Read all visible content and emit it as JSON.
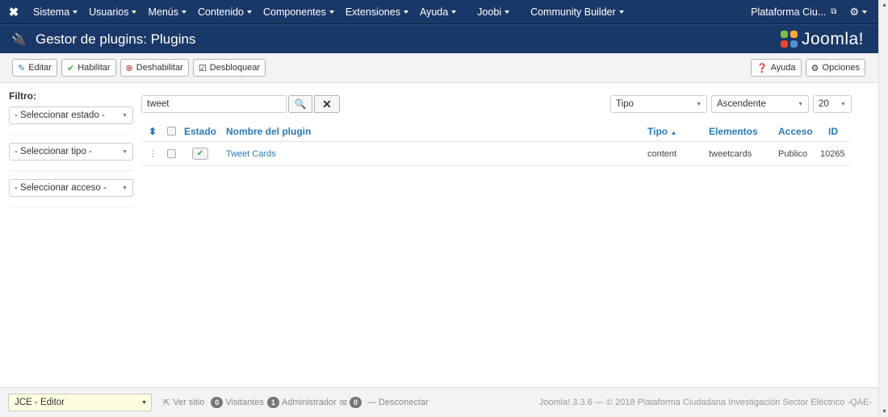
{
  "navbar": {
    "menu": [
      {
        "label": "Sistema"
      },
      {
        "label": "Usuarios"
      },
      {
        "label": "Menús"
      },
      {
        "label": "Contenido"
      },
      {
        "label": "Componentes"
      },
      {
        "label": "Extensiones"
      },
      {
        "label": "Ayuda"
      },
      {
        "label": "Joobi"
      },
      {
        "label": "Community Builder"
      }
    ],
    "site_label": "Plataforma Ciu..."
  },
  "header": {
    "title": "Gestor de plugins: Plugins",
    "brand": "Joomla!"
  },
  "toolbar": {
    "edit": "Editar",
    "enable": "Habilitar",
    "disable": "Deshabilitar",
    "unlock": "Desbloquear",
    "help": "Ayuda",
    "options": "Opciones"
  },
  "filter": {
    "label": "Filtro:",
    "state": "- Seleccionar estado -",
    "type": "- Seleccionar tipo -",
    "access": "- Seleccionar acceso -"
  },
  "search": {
    "value": "tweet"
  },
  "list_controls": {
    "order_field": "Tipo",
    "direction": "Ascendente",
    "limit": "20"
  },
  "table": {
    "headers": {
      "state": "Estado",
      "name": "Nombre del plugin",
      "type": "Tipo",
      "elements": "Elementos",
      "access": "Acceso",
      "id": "ID"
    },
    "rows": [
      {
        "name": "Tweet Cards",
        "type": "content",
        "element": "tweetcards",
        "access": "Publico",
        "id": "10265"
      }
    ]
  },
  "footer": {
    "editor": "JCE - Editor",
    "view_site": "Ver sitio",
    "visitors_count": "0",
    "visitors": "Visitantes",
    "admins_count": "1",
    "admins": "Administrador",
    "messages_count": "0",
    "logout": "Desconectar",
    "copyright": "Joomla! 3.3.6 — © 2018 Plataforma Ciudadana Investigación Sector Eléctrico -QAE-"
  },
  "colors": {
    "navbar": "#1a3867",
    "link": "#2a7ab5",
    "enabled_check": "#46a546"
  },
  "icons": {
    "logo": "joomla-icon",
    "header": "plug-icon",
    "edit": "edit-icon",
    "enable": "check-icon",
    "disable": "times-circle-icon",
    "unlock": "checkbox-icon",
    "help": "question-circle-icon",
    "options": "gear-icon",
    "search": "search-icon",
    "clear": "close-icon"
  }
}
